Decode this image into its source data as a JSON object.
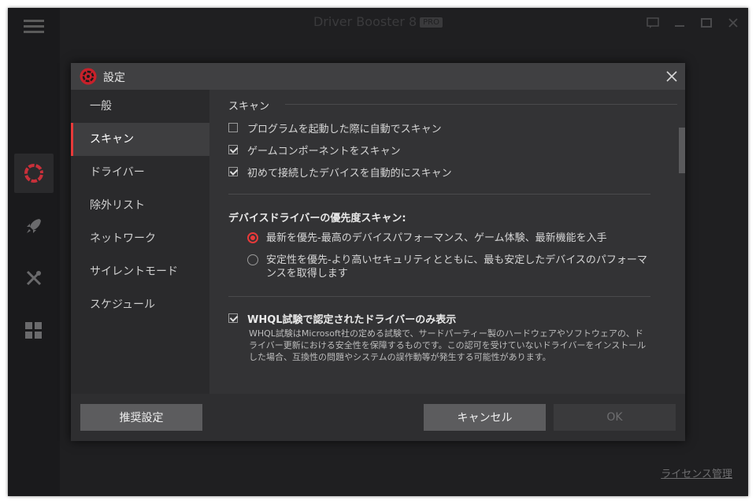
{
  "app": {
    "title": "Driver Booster 8",
    "pro_badge": "PRO",
    "license_link": "ライセンス管理",
    "rail_icons": [
      "menu-icon",
      "scan-icon",
      "rocket-icon",
      "tools-icon",
      "apps-icon"
    ]
  },
  "dialog": {
    "title": "設定",
    "sidebar": {
      "items": [
        {
          "label": "一般"
        },
        {
          "label": "スキャン"
        },
        {
          "label": "ドライバー"
        },
        {
          "label": "除外リスト"
        },
        {
          "label": "ネットワーク"
        },
        {
          "label": "サイレントモード"
        },
        {
          "label": "スケジュール"
        }
      ],
      "active_index": 1
    },
    "scan": {
      "section_title": "スキャン",
      "checkboxes": [
        {
          "label": "プログラムを起動した際に自動でスキャン",
          "checked": false
        },
        {
          "label": "ゲームコンポーネントをスキャン",
          "checked": true
        },
        {
          "label": "初めて接続したデバイスを自動的にスキャン",
          "checked": true
        }
      ],
      "priority_title": "デバイスドライバーの優先度スキャン:",
      "radios": [
        {
          "label": "最新を優先-最高のデバイスパフォーマンス、ゲーム体験、最新機能を入手",
          "selected": true
        },
        {
          "label": "安定性を優先-より高いセキュリティとともに、最も安定したデバイスのパフォーマンスを取得します",
          "selected": false
        }
      ],
      "whql": {
        "label": "WHQL試験で認定されたドライバーのみ表示",
        "checked": true,
        "description": "WHQL試験はMicrosoft社の定める試験で、サードパーティー製のハードウェアやソフトウェアの、ドライバー更新における安全性を保障するものです。この認可を受けていないドライバーをインストールした場合、互換性の問題やシステムの誤作動等が発生する可能性があります。"
      }
    },
    "footer": {
      "recommended_label": "推奨設定",
      "cancel_label": "キャンセル",
      "ok_label": "OK"
    }
  },
  "colors": {
    "accent": "#e83a3a",
    "app_bg": "#1f1f21",
    "dialog_bg": "#2e2e30",
    "titlebar_bg": "#404042"
  }
}
